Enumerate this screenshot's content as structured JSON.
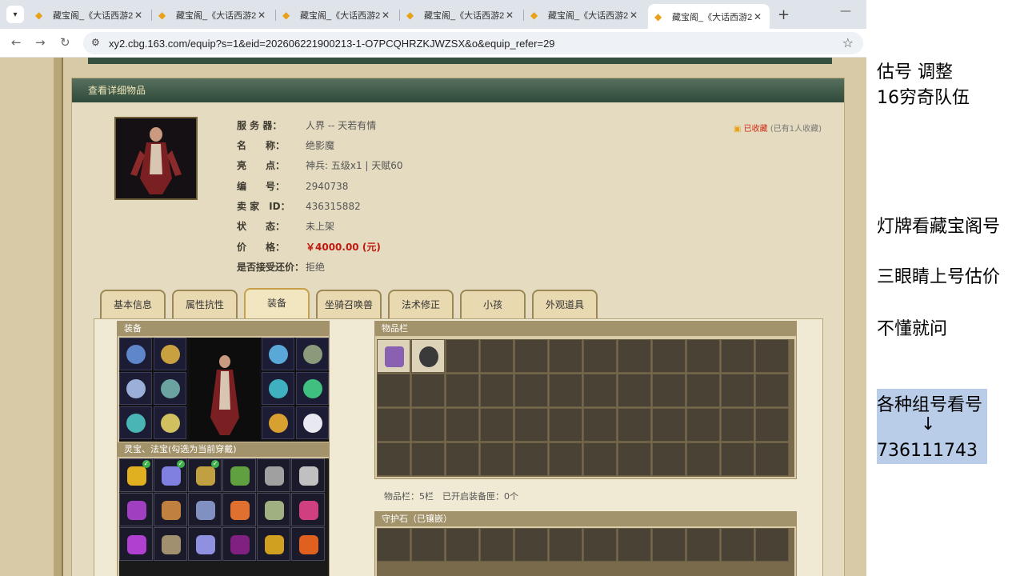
{
  "browser": {
    "tabs": [
      {
        "title": "藏宝阁_《大话西游2》",
        "close": "✕"
      },
      {
        "title": "藏宝阁_《大话西游2》",
        "close": "✕"
      },
      {
        "title": "藏宝阁_《大话西游2》",
        "close": "✕"
      },
      {
        "title": "藏宝阁_《大话西游2》",
        "close": "✕"
      },
      {
        "title": "藏宝阁_《大话西游2》",
        "close": "✕"
      },
      {
        "title": "藏宝阁_《大话西游2》",
        "close": "✕"
      }
    ],
    "new_tab": "+",
    "url": "xy2.cbg.163.com/equip?s=1&eid=202606221900213-1-O7PCQHRZKJWZSX&o&equip_refer=29"
  },
  "panel": {
    "title": "查看详细物品"
  },
  "info": {
    "server_label": "服 务 器：",
    "server_value": "人界 -- 天若有情",
    "name_label": "名　　称：",
    "name_value": "绝影魔",
    "highlight_label": "亮　　点：",
    "highlight_value": "神兵: 五级x1 | 天赋60",
    "id_label": "编　　号：",
    "id_value": "2940738",
    "seller_label": "卖 家　ID：",
    "seller_value": "436315882",
    "status_label": "状　　态：",
    "status_value": "未上架",
    "price_label": "价　　格：",
    "price_value": "￥4000.00 (元)",
    "bargain_label": "是否接受还价：",
    "bargain_value": "拒绝",
    "fav": "已收藏",
    "fav_count": "(已有1人收藏)"
  },
  "tabs": [
    "基本信息",
    "属性抗性",
    "装备",
    "坐骑召唤兽",
    "法术修正",
    "小孩",
    "外观道具"
  ],
  "equip": {
    "title": "装备",
    "lingbao_title": "灵宝、法宝(勾选为当前穿戴)"
  },
  "items": {
    "title": "物品栏",
    "caption": "物品栏：5栏　已开启装备匣：0个",
    "guard_title": "守护石（已镶嵌）"
  },
  "notes": {
    "line1": "估号 调整",
    "line2": "16穷奇队伍",
    "line3": "灯牌看藏宝阁号",
    "line4": "三眼睛上号估价",
    "line5": "不懂就问",
    "line6": "各种组号看号",
    "arrow": "↓",
    "line7": "736111743"
  }
}
